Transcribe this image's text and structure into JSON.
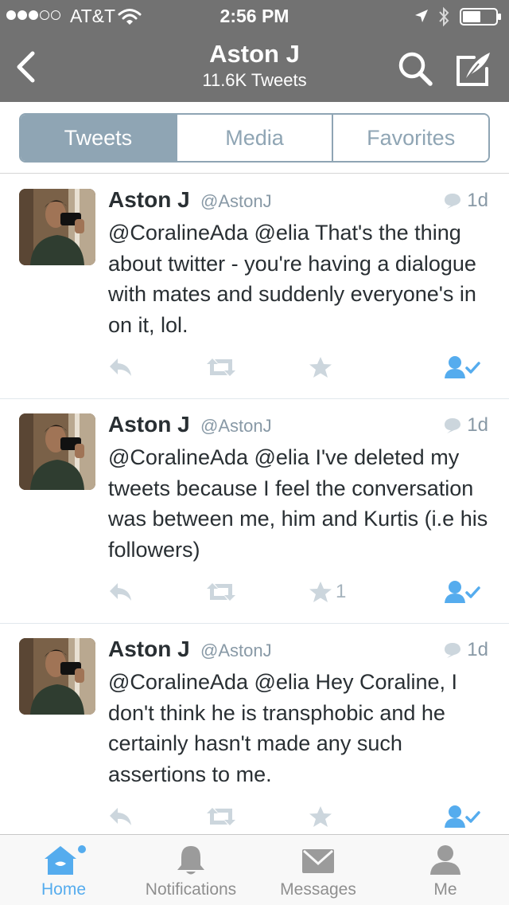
{
  "status_bar": {
    "carrier": "AT&T",
    "time": "2:56 PM",
    "signal_bars_filled": 3,
    "signal_bars_total": 5
  },
  "nav": {
    "title": "Aston J",
    "subtitle": "11.6K Tweets",
    "icons": [
      "back-icon",
      "search-icon",
      "compose-icon"
    ]
  },
  "tabs": [
    {
      "label": "Tweets",
      "active": true
    },
    {
      "label": "Media",
      "active": false
    },
    {
      "label": "Favorites",
      "active": false
    }
  ],
  "tweets": [
    {
      "name": "Aston J",
      "handle": "@AstonJ",
      "time": "1d",
      "text": "@CoralineAda @elia That's the thing about twitter - you're having a dialogue with mates and suddenly everyone's in on it, lol.",
      "favorites": ""
    },
    {
      "name": "Aston J",
      "handle": "@AstonJ",
      "time": "1d",
      "text": "@CoralineAda @elia I've deleted my tweets because I feel the conversation was between me, him and Kurtis (i.e his followers)",
      "favorites": "1"
    },
    {
      "name": "Aston J",
      "handle": "@AstonJ",
      "time": "1d",
      "text": "@CoralineAda @elia Hey Coraline, I don't think he is transphobic and he certainly hasn't made any such assertions to me.",
      "favorites": ""
    }
  ],
  "tab_bar": [
    {
      "label": "Home",
      "icon": "home-icon",
      "active": true
    },
    {
      "label": "Notifications",
      "icon": "bell-icon",
      "active": false
    },
    {
      "label": "Messages",
      "icon": "envelope-icon",
      "active": false
    },
    {
      "label": "Me",
      "icon": "person-icon",
      "active": false
    }
  ],
  "colors": {
    "header_bg": "#727272",
    "segment_accent": "#8fa5b4",
    "twitter_blue": "#55acee",
    "meta_gray": "#8899a6"
  }
}
